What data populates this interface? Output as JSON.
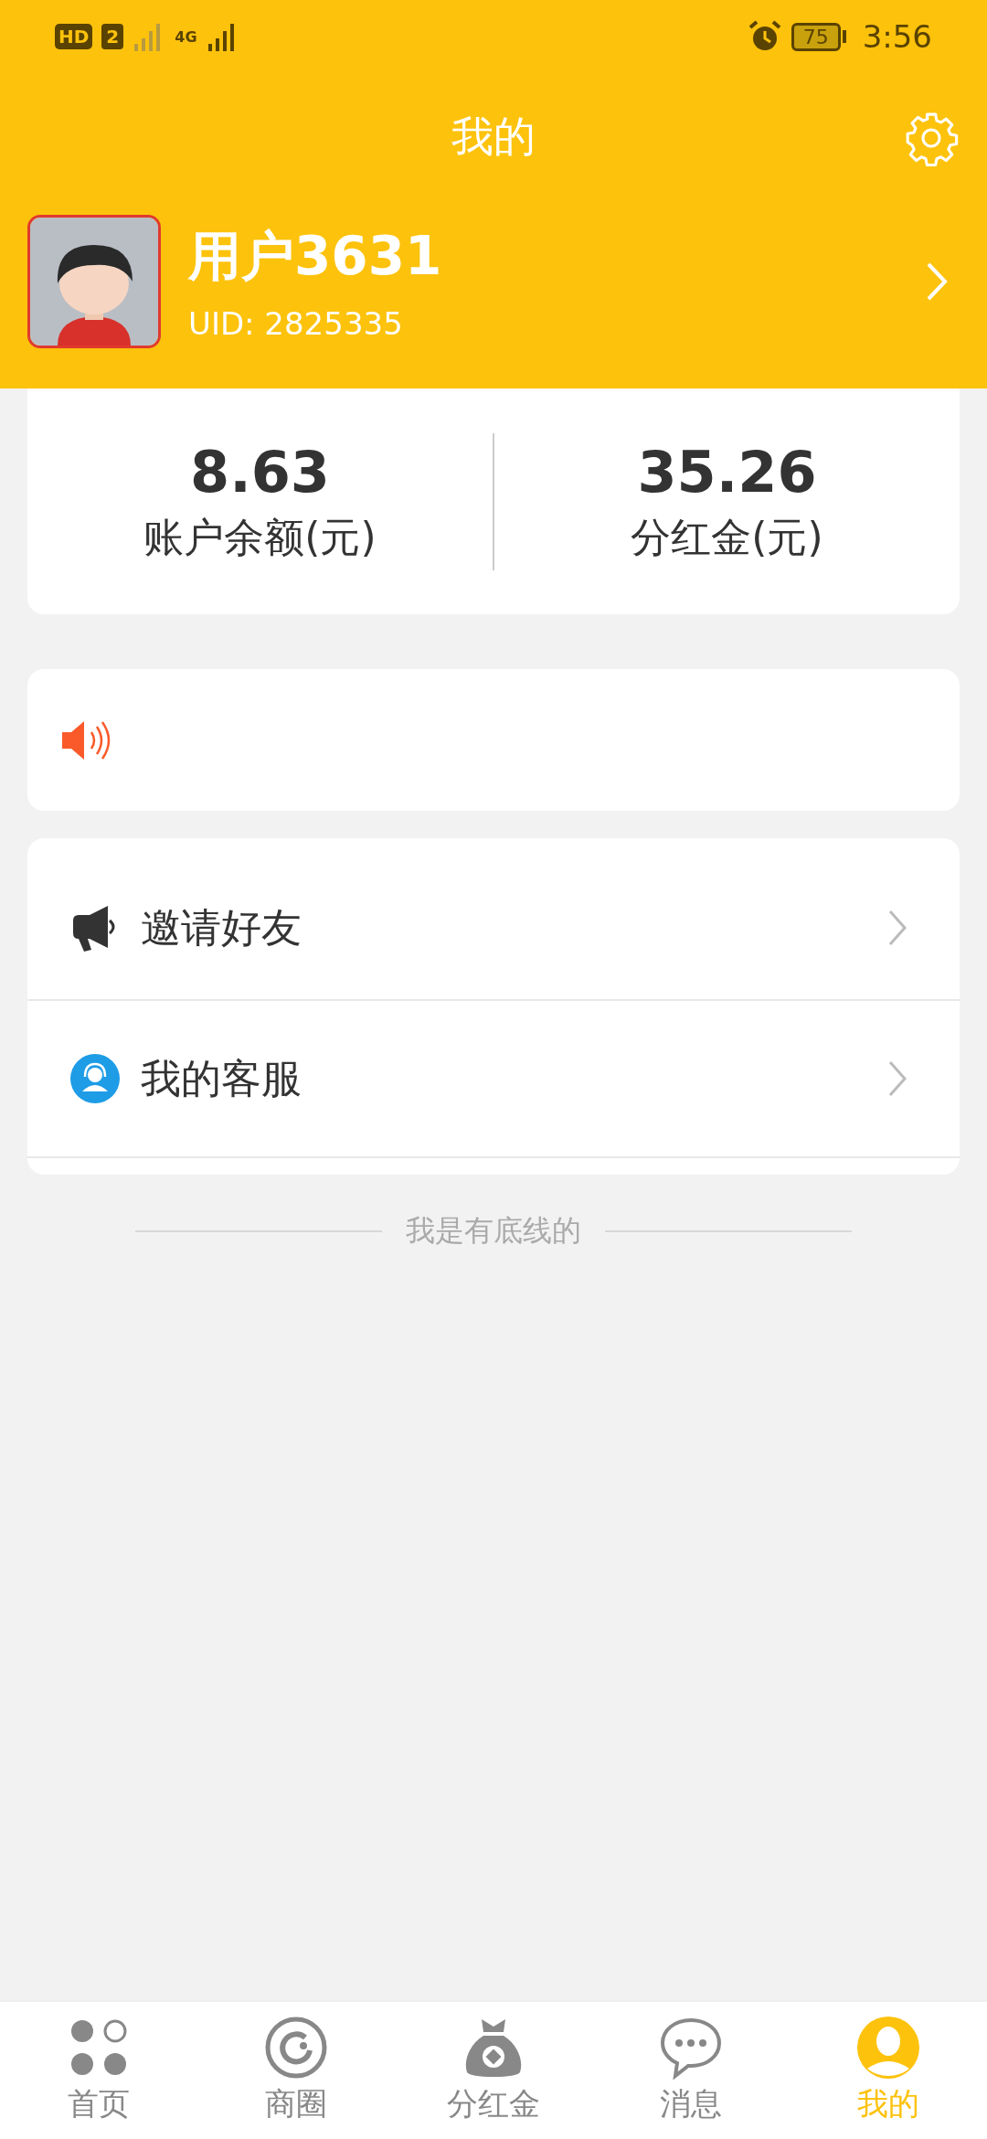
{
  "status_bar": {
    "hd": "HD",
    "sim": "2",
    "network": "4G",
    "battery": "75",
    "time": "3:56"
  },
  "header": {
    "title": "我的"
  },
  "profile": {
    "name": "用户3631",
    "uid": "UID: 2825335"
  },
  "stats": [
    {
      "value": "8.63",
      "label": "账户余额(元)"
    },
    {
      "value": "35.26",
      "label": "分红金(元)"
    }
  ],
  "menu": [
    {
      "kind": "invite",
      "label": "邀请好友"
    },
    {
      "kind": "service",
      "label": "我的客服"
    }
  ],
  "footer": "我是有底线的",
  "nav": [
    {
      "kind": "home",
      "label": "首页",
      "selected": false
    },
    {
      "kind": "circle",
      "label": "商圈",
      "selected": false
    },
    {
      "kind": "bag",
      "label": "分红金",
      "selected": false
    },
    {
      "kind": "chat",
      "label": "消息",
      "selected": false
    },
    {
      "kind": "profile",
      "label": "我的",
      "selected": true
    }
  ]
}
